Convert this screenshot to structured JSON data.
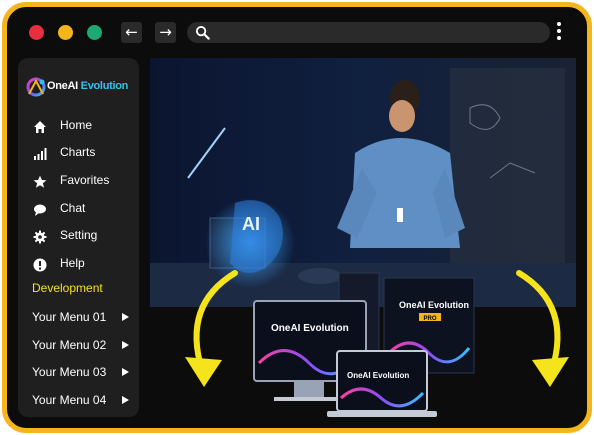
{
  "browser": {
    "window_controls": [
      "close",
      "minimize",
      "maximize"
    ],
    "back_icon": "←",
    "forward_icon": "→",
    "search": {
      "value": "",
      "placeholder": ""
    }
  },
  "sidebar": {
    "brand": {
      "part1": "OneAI",
      "part2": " Evolution"
    },
    "menu": [
      {
        "label": "Home",
        "icon": "home-icon"
      },
      {
        "label": "Charts",
        "icon": "bar-chart-icon"
      },
      {
        "label": "Favorites",
        "icon": "star-icon"
      },
      {
        "label": "Chat",
        "icon": "chat-bubble-icon"
      },
      {
        "label": "Setting",
        "icon": "gear-icon"
      },
      {
        "label": "Help",
        "icon": "help-icon"
      }
    ],
    "section_label": "Development",
    "submenus": [
      {
        "label": "Your Menu 01"
      },
      {
        "label": "Your Menu 02"
      },
      {
        "label": "Your Menu 03"
      },
      {
        "label": "Your Menu 04"
      }
    ]
  },
  "hero": {
    "hologram_text": "AI",
    "box_brand": "OneAI Evolution",
    "box_badge": "PRO"
  },
  "colors": {
    "frame": "#f5b51c",
    "background": "#0c0c0c",
    "sidebar": "#1f1f1f",
    "accent_text": "#f5e31c",
    "brand_cyan": "#31c1f0"
  }
}
